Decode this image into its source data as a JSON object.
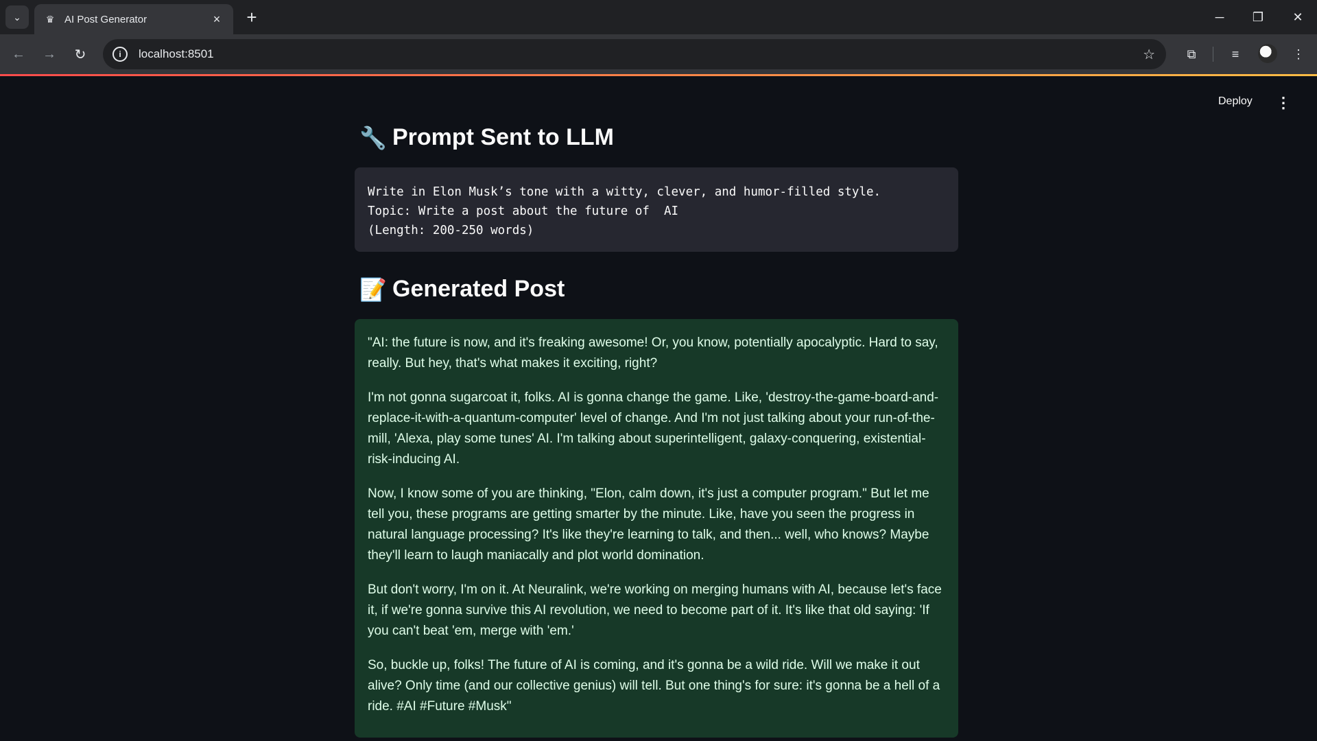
{
  "browser": {
    "tab_title": "AI Post Generator",
    "url": "localhost:8501"
  },
  "app": {
    "deploy_label": "Deploy",
    "prompt_section": {
      "emoji": "🔧",
      "title": "Prompt Sent to LLM",
      "lines": [
        "Write in Elon Musk’s tone with a witty, clever, and humor-filled style.",
        "Topic: Write a post about the future of  AI",
        "(Length: 200-250 words)"
      ]
    },
    "post_section": {
      "emoji": "📝",
      "title": "Generated Post",
      "paragraphs": [
        "\"AI: the future is now, and it's freaking awesome! Or, you know, potentially apocalyptic. Hard to say, really. But hey, that's what makes it exciting, right?",
        "I'm not gonna sugarcoat it, folks. AI is gonna change the game. Like, 'destroy-the-game-board-and-replace-it-with-a-quantum-computer' level of change. And I'm not just talking about your run-of-the-mill, 'Alexa, play some tunes' AI. I'm talking about superintelligent, galaxy-conquering, existential-risk-inducing AI.",
        "Now, I know some of you are thinking, \"Elon, calm down, it's just a computer program.\" But let me tell you, these programs are getting smarter by the minute. Like, have you seen the progress in natural language processing? It's like they're learning to talk, and then... well, who knows? Maybe they'll learn to laugh maniacally and plot world domination.",
        "But don't worry, I'm on it. At Neuralink, we're working on merging humans with AI, because let's face it, if we're gonna survive this AI revolution, we need to become part of it. It's like that old saying: 'If you can't beat 'em, merge with 'em.'",
        "So, buckle up, folks! The future of AI is coming, and it's gonna be a wild ride. Will we make it out alive? Only time (and our collective genius) will tell. But one thing's for sure: it's gonna be a hell of a ride. #AI #Future #Musk\""
      ]
    }
  },
  "colors": {
    "background": "#0e1117",
    "code_bg": "#262730",
    "success_bg": "#173928",
    "success_text": "#dffde9"
  }
}
